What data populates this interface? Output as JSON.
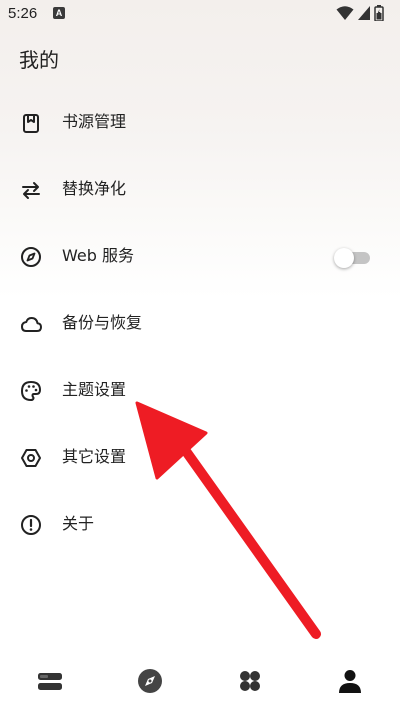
{
  "status_bar": {
    "time": "5:26",
    "app_badge": "A",
    "icons": [
      "wifi-icon",
      "signal-icon",
      "battery-icon"
    ]
  },
  "page": {
    "title": "我的"
  },
  "menu": {
    "items": [
      {
        "label": "书源管理",
        "icon": "book-source-icon"
      },
      {
        "label": "替换净化",
        "icon": "swap-arrows-icon"
      },
      {
        "label": "Web 服务",
        "icon": "compass-icon",
        "toggle": false
      },
      {
        "label": "备份与恢复",
        "icon": "cloud-icon"
      },
      {
        "label": "主题设置",
        "icon": "palette-icon"
      },
      {
        "label": "其它设置",
        "icon": "hexagon-settings-icon"
      },
      {
        "label": "关于",
        "icon": "info-icon"
      }
    ]
  },
  "annotation": {
    "color": "#ee1c24"
  },
  "bottom_nav": {
    "tabs": [
      {
        "name": "bookshelf",
        "icon": "bookshelf-icon"
      },
      {
        "name": "explore",
        "icon": "compass-icon"
      },
      {
        "name": "rss",
        "icon": "four-petal-icon"
      },
      {
        "name": "my",
        "icon": "person-icon",
        "active": true
      }
    ]
  }
}
